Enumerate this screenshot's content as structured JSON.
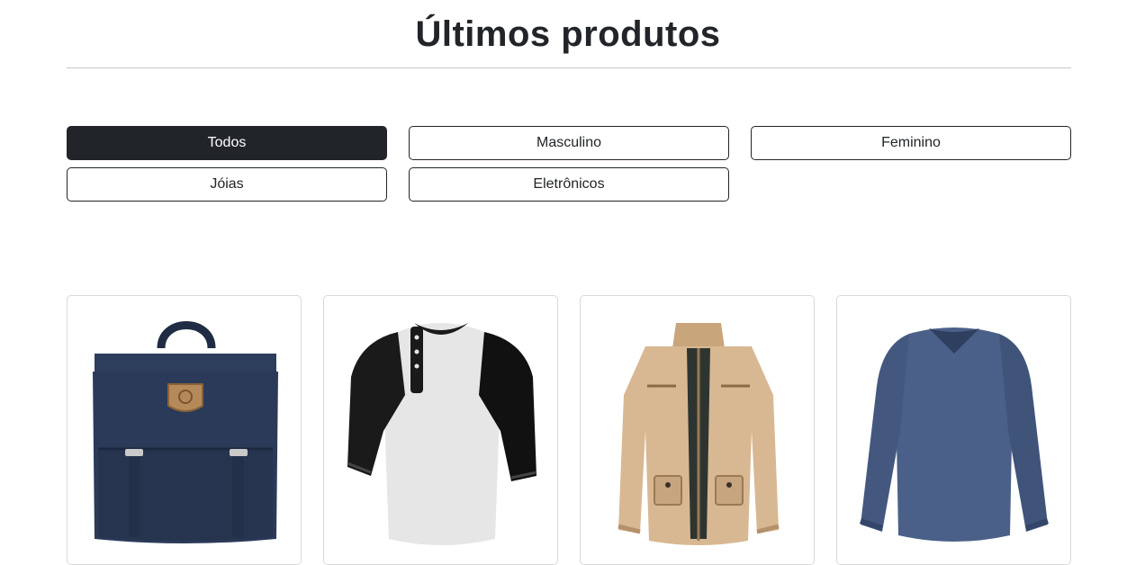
{
  "page": {
    "title": "Últimos produtos"
  },
  "filters": [
    {
      "label": "Todos",
      "active": true
    },
    {
      "label": "Masculino",
      "active": false
    },
    {
      "label": "Feminino",
      "active": false
    },
    {
      "label": "Jóias",
      "active": false
    },
    {
      "label": "Eletrônicos",
      "active": false
    }
  ],
  "products": [
    {
      "image": "navy-backpack"
    },
    {
      "image": "raglan-henley-shirt"
    },
    {
      "image": "khaki-cotton-jacket"
    },
    {
      "image": "blue-long-sleeve-tshirt"
    }
  ],
  "colors": {
    "dark": "#212529",
    "backpack": "#2a3a58",
    "jacket": "#d8b892",
    "sweater": "#4a6089"
  }
}
